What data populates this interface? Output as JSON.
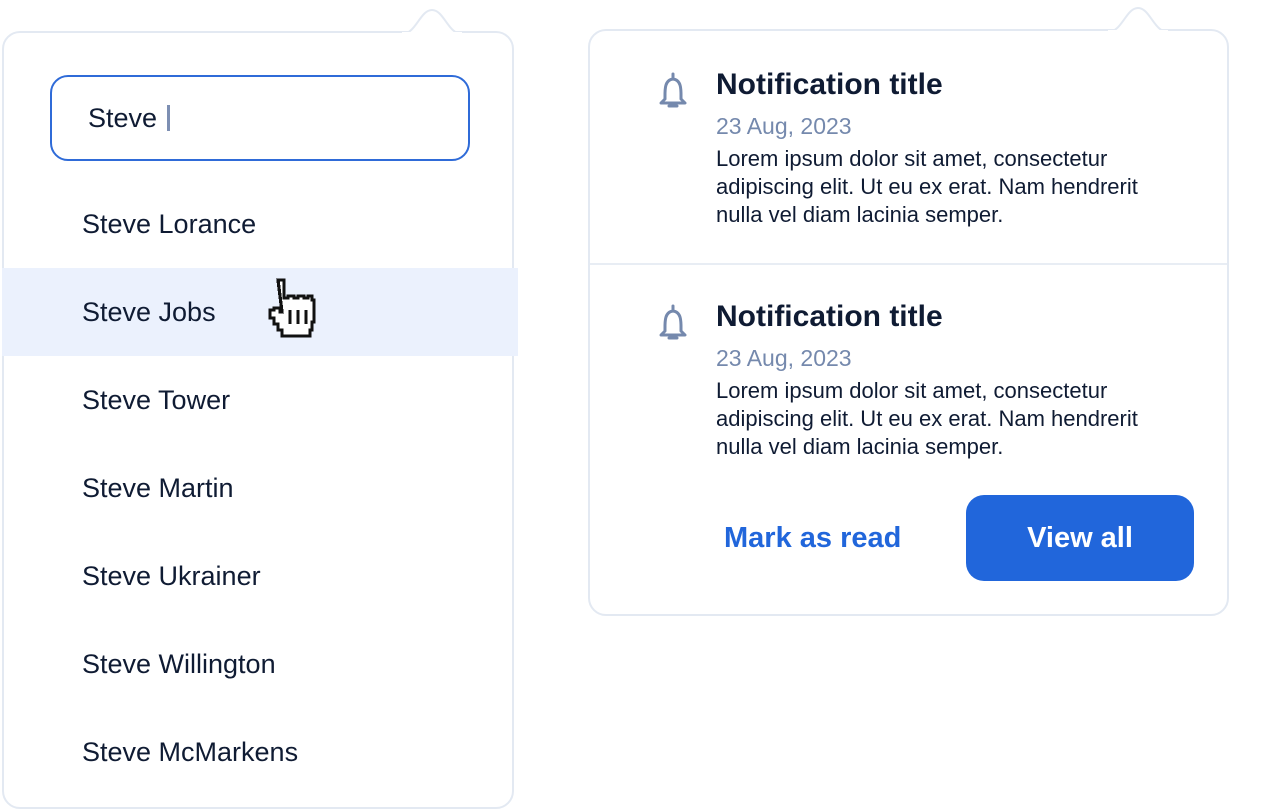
{
  "colors": {
    "accent": "#2166db",
    "highlight_row": "#ebf1fd",
    "panel_border": "#e3e9f2",
    "muted_text": "#7589ad",
    "text": "#0f1b33"
  },
  "search": {
    "value": "Steve",
    "results": [
      {
        "label": "Steve Lorance"
      },
      {
        "label": "Steve Jobs"
      },
      {
        "label": "Steve Tower"
      },
      {
        "label": "Steve Martin"
      },
      {
        "label": "Steve Ukrainer"
      },
      {
        "label": "Steve Willington"
      },
      {
        "label": "Steve McMarkens"
      }
    ],
    "highlighted_index": 1,
    "cursor_icon": "pointer-hand-icon"
  },
  "notifications": {
    "items": [
      {
        "icon": "bell-icon",
        "title": "Notification title",
        "date": "23 Aug, 2023",
        "body": "Lorem ipsum dolor sit amet, consectetur adipiscing elit. Ut eu ex erat. Nam hendrerit nulla vel diam lacinia semper."
      },
      {
        "icon": "bell-icon",
        "title": "Notification title",
        "date": "23 Aug, 2023",
        "body": "Lorem ipsum dolor sit amet, consectetur adipiscing elit. Ut eu ex erat. Nam hendrerit nulla vel diam lacinia semper."
      }
    ],
    "mark_read_label": "Mark as read",
    "view_all_label": "View all"
  }
}
